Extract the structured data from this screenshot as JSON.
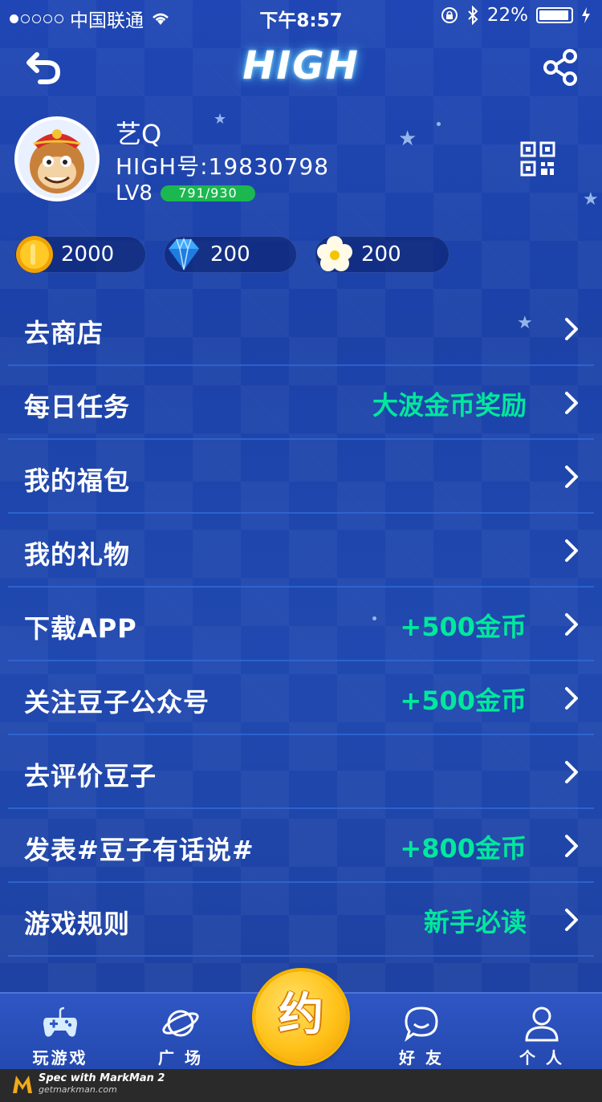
{
  "status_bar": {
    "carrier": "中国联通",
    "time": "下午8:57",
    "battery": "22%"
  },
  "header": {
    "title": "HIGH",
    "back_icon": "back-arrow-icon",
    "share_icon": "share-icon"
  },
  "profile": {
    "nickname": "艺Q",
    "user_id": "HIGH号:19830798",
    "level": "LV8",
    "exp": "791/930",
    "exp_progress": 0.85,
    "qr_icon": "qr-code-icon"
  },
  "currencies": [
    {
      "icon": "gold-coin-icon",
      "value": "2000"
    },
    {
      "icon": "diamond-icon",
      "value": "200"
    },
    {
      "icon": "flower-icon",
      "value": "200"
    }
  ],
  "menu": [
    {
      "label": "去商店",
      "reward": ""
    },
    {
      "label": "每日任务",
      "reward": "大波金币奖励"
    },
    {
      "label": "我的福包",
      "reward": ""
    },
    {
      "label": "我的礼物",
      "reward": ""
    },
    {
      "label": "下载APP",
      "reward": "+500金币"
    },
    {
      "label": "关注豆子公众号",
      "reward": "+500金币"
    },
    {
      "label": "去评价豆子",
      "reward": ""
    },
    {
      "label": "发表#豆子有话说#",
      "reward": "+800金币"
    },
    {
      "label": "游戏规则",
      "reward": "新手必读"
    }
  ],
  "tabbar": {
    "tabs": [
      {
        "label": "玩游戏",
        "icon": "gamepad-icon"
      },
      {
        "label": "广 场",
        "icon": "planet-icon"
      },
      {
        "label": "好 友",
        "icon": "chat-bubble-icon"
      },
      {
        "label": "个 人",
        "icon": "person-icon"
      }
    ],
    "center_label": "约"
  },
  "footer": {
    "brand_line1": "Spec with MarkMan 2",
    "brand_line2": "getmarkman.com"
  },
  "colors": {
    "reward_green": "#00e89c",
    "background_blue": "#1f46b4",
    "exp_bar_green": "#1bb84f",
    "center_gold": "#ffc21a"
  }
}
